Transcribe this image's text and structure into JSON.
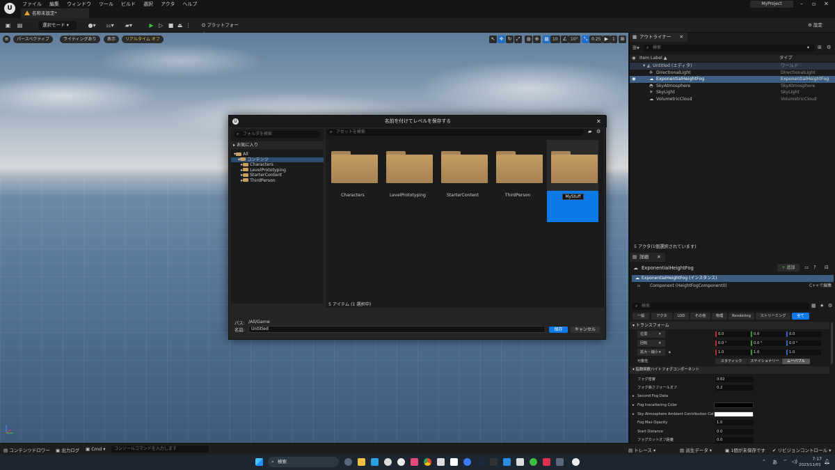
{
  "menubar": {
    "menus": [
      "ファイル",
      "編集",
      "ウィンドウ",
      "ツール",
      "ビルド",
      "選択",
      "アクタ",
      "ヘルプ"
    ],
    "project": "MyProject",
    "tab": "名称未設定*"
  },
  "toolbar": {
    "mode": "選択モード",
    "platform": "プラットフォーム",
    "settings": "設定"
  },
  "viewport": {
    "perspective": "パースペクティブ",
    "lighting": "ライティングあり",
    "show": "表示",
    "realtime": "リアルタイム オフ",
    "grid_snap": "10",
    "rot_snap": "10°",
    "scale_snap": "0.25",
    "cam_speed": "1"
  },
  "dialog": {
    "title": "名前を付けてレベルを保存する",
    "folder_search": "フォルダを検索",
    "favorites": "お気に入り",
    "tree": [
      "All",
      "コンテンツ",
      "Characters",
      "LevelPrototyping",
      "StarterContent",
      "ThirdPerson"
    ],
    "asset_search": "アセットを検索",
    "tiles": [
      "Characters",
      "LevelPrototyping",
      "StarterContent",
      "ThirdPerson",
      "MyStuff"
    ],
    "count": "5 アイテム (1 選択中)",
    "path_label": "パス:",
    "path_value": "/All/Game",
    "name_label": "名前:",
    "name_value": "Untitled",
    "save": "保存",
    "cancel": "キャンセル"
  },
  "outliner": {
    "tab": "アウトライナー",
    "search": "検索",
    "col_label": "Item Label ▲",
    "col_type": "タイプ",
    "rows": [
      {
        "label": "Untitled (エディタ)",
        "type": "ワールド"
      },
      {
        "label": "DirectionalLight",
        "type": "DirectionalLight"
      },
      {
        "label": "ExponentialHeightFog",
        "type": "ExponentialHeightFog"
      },
      {
        "label": "SkyAtmosphere",
        "type": "SkyAtmosphere"
      },
      {
        "label": "SkyLight",
        "type": "SkyLight"
      },
      {
        "label": "VolumetricCloud",
        "type": "VolumetricCloud"
      }
    ],
    "status": "5 アクタ(1個選択されています)"
  },
  "details": {
    "tab": "詳細",
    "actor": "ExponentialHeightFog",
    "add": "追加",
    "instance": "ExponentialHeightFog (インスタンス)",
    "component": "Component (HeightFogComponent0)",
    "cpp": "C++で編集",
    "search": "検索",
    "categories": [
      "一般",
      "アクタ",
      "LOD",
      "その他",
      "物理",
      "Rendering",
      "ストリーミング",
      "全て"
    ],
    "transform": "トランスフォーム",
    "location": "位置",
    "rotation": "回転",
    "scale": "拡大・縮小",
    "loc": [
      "0.0",
      "0.0",
      "0.0"
    ],
    "rot": [
      "0.0 °",
      "0.0 °",
      "0.0 °"
    ],
    "scl": [
      "1.0",
      "1.0",
      "1.0"
    ],
    "mobility": "可動性",
    "mob": [
      "スタティック",
      "ステイショナリー",
      "ムーバブル"
    ],
    "fog_section": "指数関数ハイトフォグコンポーネント",
    "fog_density": "フォグ密度",
    "fog_density_v": "0.02",
    "fog_falloff": "フォグ高さフォールオフ",
    "fog_falloff_v": "0.2",
    "second": "Second Fog Data",
    "inscatter": "Fog Inscattering Color",
    "skycolor": "Sky Atmosphere Ambient Contribution Color...",
    "maxop": "Fog Max Opacity",
    "maxop_v": "1.0",
    "startd": "Start Distance",
    "startd_v": "0.0",
    "cutoff": "フォグカットオフ距離",
    "cutoff_v": "0.0"
  },
  "statusbar": {
    "drawer": "コンテンツドロワー",
    "log": "出力ログ",
    "cmd": "Cmd",
    "console": "コンソールコマンドを入力します",
    "trace": "トレース",
    "derived": "派生データ",
    "unsaved": "1個が未保存です",
    "source": "リビジョンコントロール"
  },
  "taskbar": {
    "search": "検索",
    "time": "7:17",
    "date": "2023/11/01"
  }
}
